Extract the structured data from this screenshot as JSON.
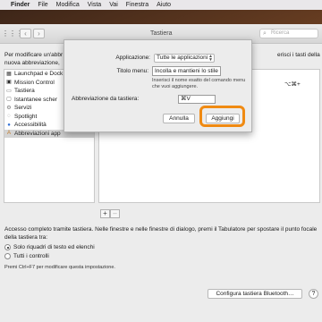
{
  "menubar": {
    "apple": "",
    "items": [
      "Finder",
      "File",
      "Modifica",
      "Vista",
      "Vai",
      "Finestra",
      "Aiuto"
    ]
  },
  "window": {
    "title": "Tastiera",
    "search_placeholder": "Ricerca",
    "nav_back": "‹",
    "nav_forward": "›",
    "grid_icon": "⋮⋮⋮"
  },
  "left_description": "Per modificare un'abbr nuova abbreviazione,",
  "right_description": "erisci i tasti della",
  "categories": [
    {
      "label": "Launchpad e Dock",
      "icon": "launchpad-icon",
      "glyph": "▦",
      "color": "#333333"
    },
    {
      "label": "Mission Control",
      "icon": "mission-control-icon",
      "glyph": "▣",
      "color": "#2a2a2a"
    },
    {
      "label": "Tastiera",
      "icon": "keyboard-icon",
      "glyph": "▭",
      "color": "#555555"
    },
    {
      "label": "Istantanee scher",
      "icon": "screenshot-icon",
      "glyph": "▢",
      "color": "#666666"
    },
    {
      "label": "Servizi",
      "icon": "services-icon",
      "glyph": "⚙",
      "color": "#777777"
    },
    {
      "label": "Spotlight",
      "icon": "spotlight-icon",
      "glyph": "◌",
      "color": "#555555"
    },
    {
      "label": "Accessibilità",
      "icon": "accessibility-icon",
      "glyph": "●",
      "color": "#2f6fd6"
    },
    {
      "label": "Abbreviazioni app",
      "icon": "app-shortcuts-icon",
      "glyph": "A",
      "color": "#c07a2a",
      "selected": true
    }
  ],
  "shortcut_key_display": "⌥⌘+",
  "plus_label": "+",
  "minus_label": "–",
  "keyboard_access": {
    "text": "Accesso completo tramite tastiera. Nelle finestre e nelle finestre di dialogo, premi il Tabulatore per spostare il punto focale della tastiera tra:",
    "option1": "Solo riquadri di testo ed elenchi",
    "option2": "Tutti i controlli",
    "hint": "Premi Ctrl+F7 per modificare questa impostazione."
  },
  "bluetooth_button": "Configura tastiera Bluetooth…",
  "help_button": "?",
  "sheet": {
    "app_label": "Applicazione:",
    "app_value": "Tutte le applicazioni",
    "menu_title_label": "Titolo menu:",
    "menu_title_value": "Incolla e mantieni lo stile",
    "menu_help": "Inserisci il nome esatto del comando menu che vuoi aggiungere.",
    "shortcut_label": "Abbreviazione da tastiera:",
    "shortcut_value": "⌘V",
    "cancel_label": "Annulla",
    "add_label": "Aggiungi",
    "highlight_color": "#f08a12"
  }
}
